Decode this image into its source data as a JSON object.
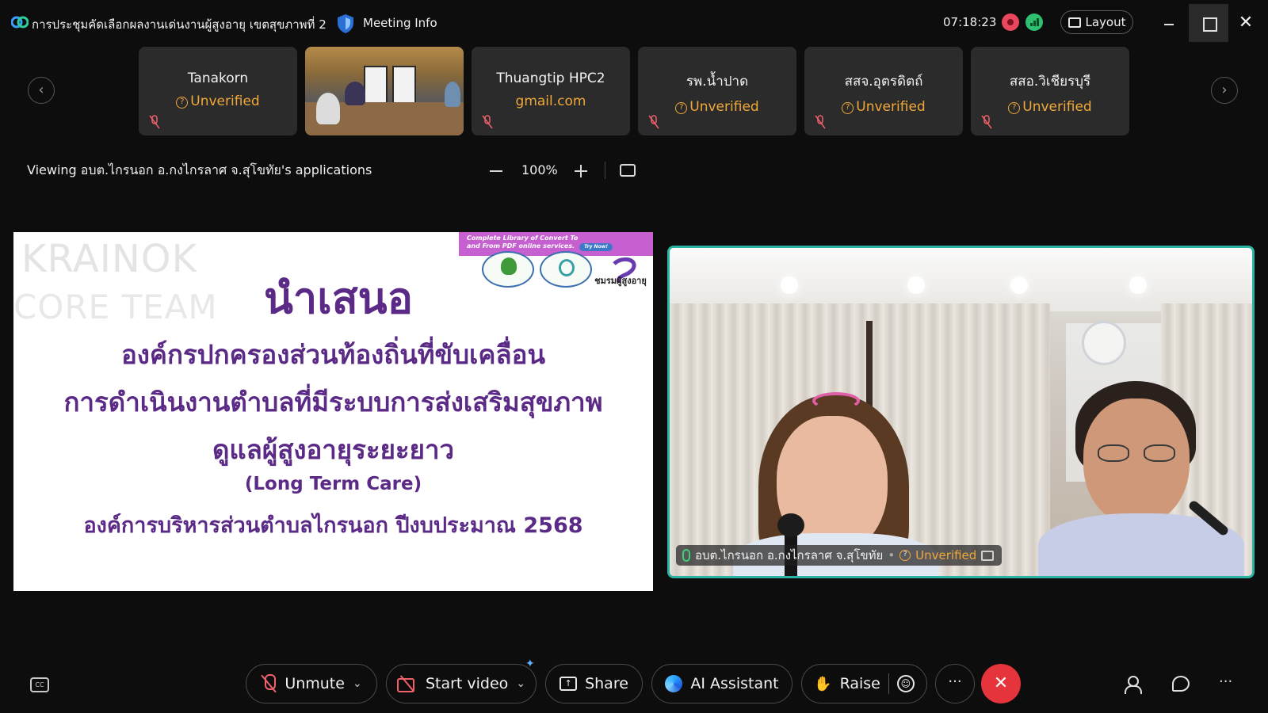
{
  "titlebar": {
    "meeting_title": "การประชุมคัดเลือกผลงานเด่นงานผู้สูงอายุ เขตสุขภาพที่ 2",
    "meeting_info": "Meeting Info",
    "clock": "07:18:23",
    "layout_label": "Layout",
    "close_glyph": "✕"
  },
  "participants": [
    {
      "name": "Tanakorn",
      "status": "Unverified"
    },
    {
      "name": "",
      "status": "",
      "video": true
    },
    {
      "name": "Thuangtip HPC2",
      "status": "gmail.com"
    },
    {
      "name": "รพ.น้ำปาด",
      "status": "Unverified"
    },
    {
      "name": "สสจ.อุตรดิตถ์",
      "status": "Unverified"
    },
    {
      "name": "สสอ.วิเชียรบุรี",
      "status": "Unverified"
    }
  ],
  "share_toolbar": {
    "viewing": "Viewing อบต.ไกรนอก อ.กงไกรลาศ จ.สุโขทัย's applications",
    "zoom": "100%"
  },
  "slide": {
    "watermark1": "KRAINOK",
    "watermark2": "CORE TEAM",
    "title": "นำเสนอ",
    "line1": "องค์กรปกครองส่วนท้องถิ่นที่ขับเคลื่อน",
    "line2": "การดำเนินงานตำบลที่มีระบบการส่งเสริมสุขภาพ",
    "line3": "ดูแลผู้สูงอายุระยะยาว",
    "line4": "(Long Term Care)",
    "line5": "องค์การบริหารส่วนตำบลไกรนอก ปีงบประมาณ 2568",
    "ad_line1": "Complete Library of Convert To",
    "ad_line2": "and From PDF online services.",
    "ad_button": "Try Now!",
    "elder_logo_text": "ชมรมผู้สูงอายุ"
  },
  "speaker": {
    "name": "อบต.ไกรนอก อ.กงไกรลาศ จ.สุโขทัย",
    "status": "Unverified"
  },
  "controls": {
    "unmute": "Unmute",
    "start_video": "Start video",
    "share": "Share",
    "ai_assistant": "AI Assistant",
    "raise": "Raise",
    "more": "···",
    "end": "✕"
  },
  "colors": {
    "accent_teal": "#2bb3a3",
    "warning": "#f0a83a",
    "end_red": "#e5343c",
    "slide_purple": "#5b2a86"
  }
}
